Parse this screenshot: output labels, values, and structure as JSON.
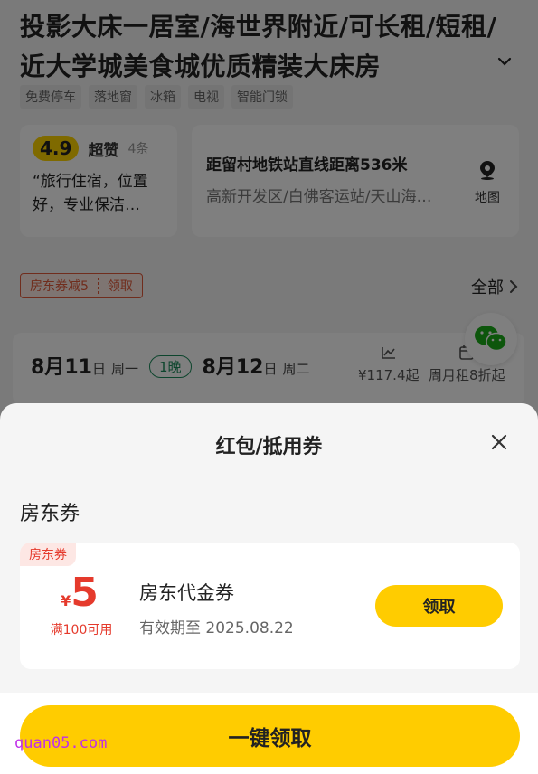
{
  "listing": {
    "title": "投影大床一居室/海世界附近/可长租/短租/近大学城美食城优质精装大床房",
    "tags": [
      "免费停车",
      "落地窗",
      "冰箱",
      "电视",
      "智能门锁"
    ],
    "rating": {
      "score": "4.9",
      "label": "超赞",
      "count": "4条",
      "review": "“旅行住宿，位置好，专业保洁…"
    },
    "location": {
      "main": "距留村地铁站直线距离536米",
      "sub": "高新开发区/白佛客运站/天山海…",
      "map_label": "地图"
    },
    "coupon_chip": {
      "text": "房东券减5",
      "action": "领取"
    },
    "all_label": "全部",
    "dates": {
      "checkin_month": "8月",
      "checkin_day": "11",
      "checkin_unit": "日",
      "checkin_week": "周一",
      "nights": "1晚",
      "checkout_month": "8月",
      "checkout_day": "12",
      "checkout_unit": "日",
      "checkout_week": "周二",
      "price_hint": "¥117.4起",
      "monthly_hint": "周月租8折起"
    }
  },
  "sheet": {
    "title": "红包/抵用券",
    "section_title": "房东券",
    "coupon": {
      "badge": "房东券",
      "currency": "¥",
      "amount": "5",
      "condition": "满100可用",
      "name": "房东代金券",
      "expiry": "有效期至 2025.08.22",
      "claim_label": "领取"
    },
    "claim_all_label": "一键领取"
  },
  "watermark": "quan05.com",
  "colors": {
    "accent": "#ffcc00",
    "coupon_red": "#e53a2c",
    "green": "#1a8a5a"
  }
}
